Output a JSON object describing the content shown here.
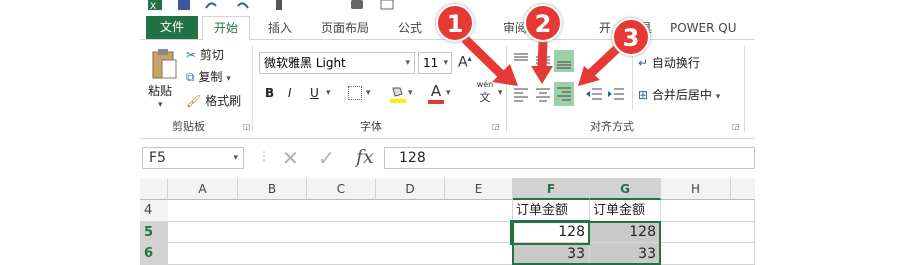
{
  "ribbon": {
    "tabs": [
      {
        "id": "file",
        "label": "文件"
      },
      {
        "id": "home",
        "label": "开始"
      },
      {
        "id": "insert",
        "label": "插入"
      },
      {
        "id": "pagelayout",
        "label": "页面布局"
      },
      {
        "id": "formulas",
        "label": "公式"
      },
      {
        "id": "review",
        "label": "审阅"
      },
      {
        "id": "dev",
        "label": "开",
        "suffix": "具"
      },
      {
        "id": "powerquery",
        "label": "POWER QU"
      }
    ],
    "clipboard": {
      "paste_label": "粘贴",
      "cut_label": "剪切",
      "copy_label": "复制",
      "format_painter_label": "格式刷",
      "group_label": "剪贴板"
    },
    "font": {
      "font_name": "微软雅黑 Light",
      "font_size": "11",
      "bold": "B",
      "italic": "I",
      "underline": "U",
      "phonetic_top": "wén",
      "phonetic_bottom": "文",
      "font_color_letter": "A",
      "group_label": "字体"
    },
    "alignment": {
      "wrap_text_label": "自动换行",
      "merge_center_label": "合并后居中",
      "group_label": "对齐方式"
    }
  },
  "formula_bar": {
    "name_box": "F5",
    "fx": "fx",
    "value": "128"
  },
  "sheet": {
    "columns": [
      "A",
      "B",
      "C",
      "D",
      "E",
      "F",
      "G",
      "H"
    ],
    "selected_columns": [
      "F",
      "G"
    ],
    "rows": [
      {
        "num": "4",
        "F": "订单金额",
        "G": "订单金额"
      },
      {
        "num": "5",
        "F": "128",
        "G": "128"
      },
      {
        "num": "6",
        "F": "33",
        "G": "33"
      }
    ]
  },
  "callouts": [
    "1",
    "2",
    "3"
  ],
  "colors": {
    "accent": "#217346",
    "highlight": "#9bd0a8",
    "callout": "#e53935",
    "selection_shade": "#c9c9c9"
  }
}
